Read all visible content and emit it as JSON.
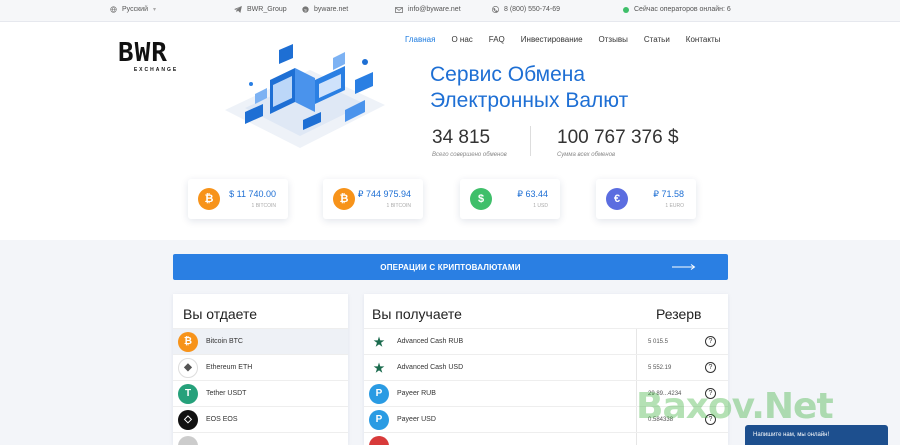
{
  "topbar": {
    "language": "Русский",
    "telegram": "BWR_Group",
    "site": "byware.net",
    "email": "info@byware.net",
    "phone": "8 (800) 550-74-69",
    "operators": "Сейчас операторов онлайн: 6"
  },
  "logo": {
    "word": "BWR",
    "sub": "EXCHANGE"
  },
  "nav": [
    "Главная",
    "О нас",
    "FAQ",
    "Инвестирование",
    "Отзывы",
    "Статьи",
    "Контакты"
  ],
  "hero": {
    "title_line1": "Сервис Обмена",
    "title_line2": "Электронных Валют",
    "stat1_value": "34 815",
    "stat1_label": "Всего совершено обменов",
    "stat2_value": "100 767 376 $",
    "stat2_label": "Сумма всех обменов"
  },
  "rates": [
    {
      "amount": "$ 11 740.00",
      "unit": "1 BITCOIN",
      "icon": "bitcoin-icon",
      "glyph": "₿",
      "color": "#f7931a"
    },
    {
      "amount": "₽ 744 975.94",
      "unit": "1 BITCOIN",
      "icon": "bitcoin-icon",
      "glyph": "₿",
      "color": "#f7931a"
    },
    {
      "amount": "₽ 63.44",
      "unit": "1 USD",
      "icon": "dollar-icon",
      "glyph": "$",
      "color": "#3fbf6a"
    },
    {
      "amount": "₽ 71.58",
      "unit": "1 EURO",
      "icon": "euro-icon",
      "glyph": "€",
      "color": "#5b6de0"
    }
  ],
  "cta": {
    "label": "ОПЕРАЦИИ С КРИПТОВАЛЮТАМИ"
  },
  "give": {
    "title": "Вы отдаете",
    "items": [
      {
        "label": "Bitcoin BTC",
        "glyph": "₿",
        "color": "#f7931a"
      },
      {
        "label": "Ethereum ETH",
        "glyph": "◆",
        "color": "#ffffff"
      },
      {
        "label": "Tether USDT",
        "glyph": "T",
        "color": "#26a17b"
      },
      {
        "label": "EOS EOS",
        "glyph": "◇",
        "color": "#111111"
      }
    ]
  },
  "receive": {
    "title": "Вы получаете",
    "reserve_title": "Резерв",
    "items": [
      {
        "label": "Advanced Cash RUB",
        "reserve": "5 015.5",
        "glyph": "★",
        "color": "#ffffff"
      },
      {
        "label": "Advanced Cash USD",
        "reserve": "5 552.19",
        "glyph": "★",
        "color": "#ffffff"
      },
      {
        "label": "Payeer RUB",
        "reserve": "29 89...4234",
        "glyph": "P",
        "color": "#2a9be3"
      },
      {
        "label": "Payeer USD",
        "reserve": "0.584338",
        "glyph": "P",
        "color": "#2a9be3"
      }
    ]
  },
  "watermark": "Baxov.Net",
  "chat": "Напишите нам, мы онлайн!"
}
